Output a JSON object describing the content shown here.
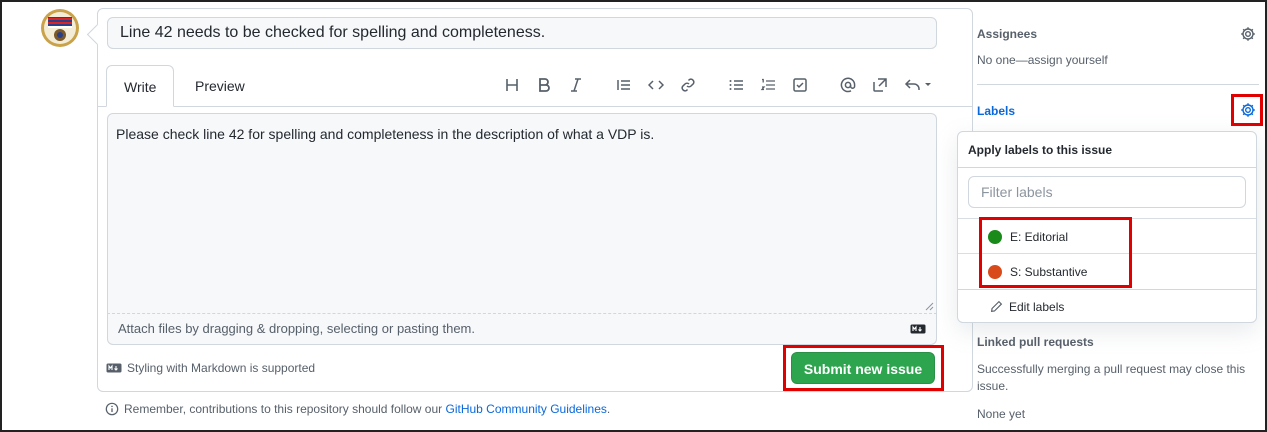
{
  "issue": {
    "title_value": "Line 42 needs to be checked for spelling and completeness.",
    "tabs": {
      "write": "Write",
      "preview": "Preview"
    },
    "body_value": "Please check line 42 for spelling and completeness in the description of what a VDP is.",
    "attach_hint": "Attach files by dragging & dropping, selecting or pasting them.",
    "markdown_note": "Styling with Markdown is supported",
    "submit_label": "Submit new issue",
    "guidelines_prefix": "Remember, contributions to this repository should follow our ",
    "guidelines_link": "GitHub Community Guidelines",
    "guidelines_suffix": "."
  },
  "toolbar": {
    "icons": [
      "heading-icon",
      "bold-icon",
      "italic-icon",
      "quote-icon",
      "code-icon",
      "link-icon",
      "bulleted-list-icon",
      "numbered-list-icon",
      "task-list-icon",
      "mention-icon",
      "reference-icon",
      "reply-icon"
    ]
  },
  "sidebar": {
    "assignees_heading": "Assignees",
    "assignees_value": "No one—assign yourself",
    "labels_heading": "Labels",
    "linked_heading": "Linked pull requests",
    "linked_text": "Successfully merging a pull request may close this issue.",
    "linked_value": "None yet"
  },
  "label_menu": {
    "header": "Apply labels to this issue",
    "filter_placeholder": "Filter labels",
    "items": [
      {
        "name": "E: Editorial",
        "color": "#1a8a1a"
      },
      {
        "name": "S: Substantive",
        "color": "#d94a1a"
      }
    ],
    "edit_label": "Edit labels"
  },
  "colors": {
    "accent": "#0969da",
    "submit": "#2da44e",
    "highlight": "#e00000"
  }
}
